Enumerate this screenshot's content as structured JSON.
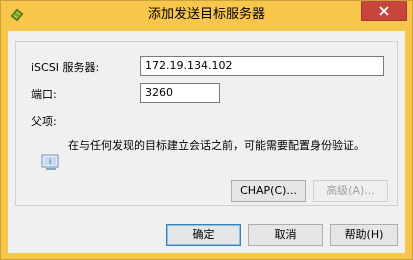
{
  "window": {
    "title": "添加发送目标服务器"
  },
  "form": {
    "server_label": "iSCSI 服务器:",
    "server_value": "172.19.134.102",
    "port_label": "端口:",
    "port_value": "3260",
    "parent_label": "父项:"
  },
  "info": {
    "icon": "info-icon",
    "text": "在与任何发现的目标建立会话之前，可能需要配置身份验证。"
  },
  "buttons": {
    "chap": "CHAP(C)...",
    "advanced": "高级(A)...",
    "ok": "确定",
    "cancel": "取消",
    "help": "帮助(H)"
  },
  "colors": {
    "titlebar": "#f8c64a",
    "close_button": "#c7453c"
  }
}
